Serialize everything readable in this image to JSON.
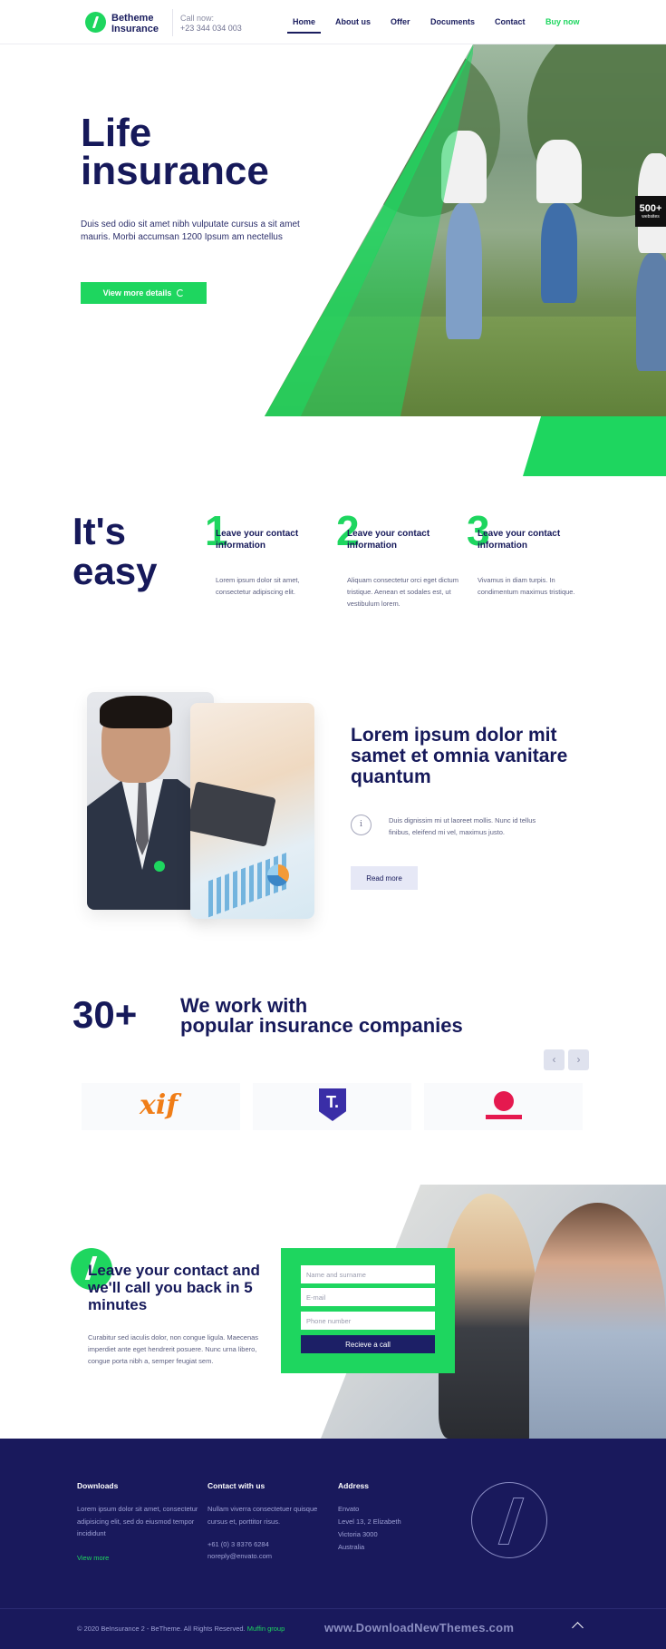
{
  "header": {
    "logo_line1": "Betheme",
    "logo_line2": "Insurance",
    "call_label": "Call now:",
    "call_number": "+23 344 034 003",
    "nav": [
      "Home",
      "About us",
      "Offer",
      "Documents",
      "Contact"
    ],
    "buy": "Buy now"
  },
  "hero": {
    "title_line1": "Life",
    "title_line2": "insurance",
    "text": "Duis sed odio sit amet nibh vulputate cursus a sit amet mauris. Morbi accumsan 1200 Ipsum am nectellus",
    "button": "View more details",
    "badge_number": "500+",
    "badge_label": "websites"
  },
  "easy": {
    "title_line1": "It's",
    "title_line2": "easy",
    "steps": [
      {
        "num": "1",
        "heading": "Leave your contact information",
        "text": "Lorem ipsum dolor sit amet, consectetur adipiscing elit."
      },
      {
        "num": "2",
        "heading": "Leave your contact information",
        "text": "Aliquam consectetur orci eget dictum tristique. Aenean et sodales est, ut vestibulum lorem."
      },
      {
        "num": "3",
        "heading": "Leave your contact information",
        "text": "Vivamus in diam turpis. In condimentum maximus tristique."
      }
    ]
  },
  "feature": {
    "title": "Lorem ipsum dolor mit samet et omnia vanitare quantum",
    "info_symbol": "i",
    "text": "Duis dignissim mi ut laoreet mollis. Nunc id tellus finibus, eleifend mi vel, maximus justo.",
    "button": "Read more"
  },
  "companies": {
    "count": "30+",
    "title_line1": "We work with",
    "title_line2": "popular insurance companies",
    "prev": "‹",
    "next": "›",
    "logo1_text": "xif",
    "logo2_text": "T."
  },
  "callback": {
    "title": "Leave your contact and we'll call you back in 5 minutes",
    "text": "Curabitur sed iaculis dolor, non congue ligula. Maecenas imperdiet ante eget hendrerit posuere. Nunc urna libero, congue porta nibh a, semper feugiat sem.",
    "name_placeholder": "Name and surname",
    "email_placeholder": "E-mail",
    "phone_placeholder": "Phone number",
    "button": "Recieve a call"
  },
  "footer": {
    "downloads_title": "Downloads",
    "downloads_text": "Lorem ipsum dolor sit amet, consectetur adipisicing elit, sed do eiusmod tempor incididunt",
    "view_more": "View more",
    "contact_title": "Contact with us",
    "contact_text": "Nullam viverra consectetuer quisque cursus et, porttitor risus.",
    "phone": "+61 (0) 3 8376 6284",
    "email": "noreply@envato.com",
    "address_title": "Address",
    "address_lines": [
      "Envato",
      "Level 13, 2 Elizabeth",
      "Victoria 3000",
      "Australia"
    ],
    "copyright": "© 2020 BeInsurance 2 - BeTheme. All Rights Reserved.",
    "copyright_link": "Muffin group",
    "watermark": "www.DownloadNewThemes.com"
  },
  "colors": {
    "accent_green": "#1ed65f",
    "navy": "#16195a",
    "footer_bg": "#19195c"
  }
}
